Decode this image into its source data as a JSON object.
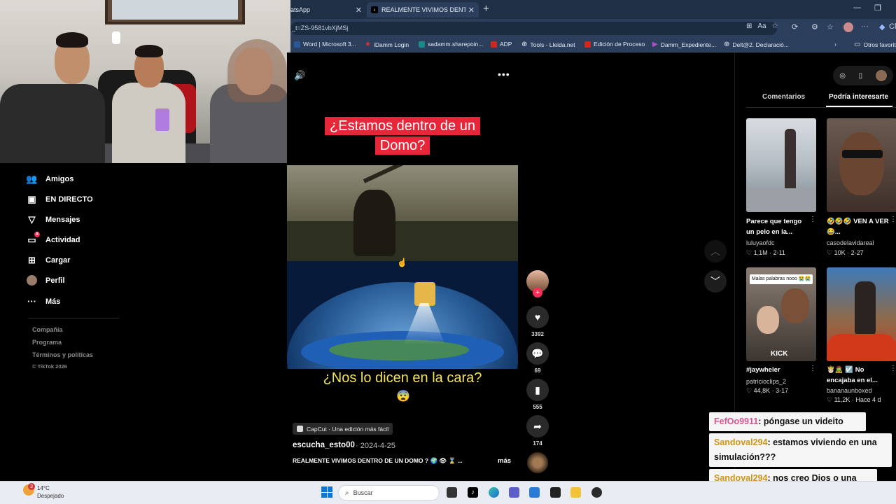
{
  "browser": {
    "tabs": [
      {
        "label": "atsApp"
      },
      {
        "label": "REALMENTE VIVIMOS DENTRO DE"
      }
    ],
    "address": "_t=ZS-9581vbXjMSj",
    "bookmarks": [
      {
        "label": "Word | Microsoft 3..."
      },
      {
        "label": "iDamm Login"
      },
      {
        "label": "sadamm.sharepoin..."
      },
      {
        "label": "ADP"
      },
      {
        "label": "Tools - Lleida.net"
      },
      {
        "label": "Edición de Proceso"
      },
      {
        "label": "Damm_Expediente..."
      },
      {
        "label": "Delt@2. Declaració..."
      },
      {
        "label": "Otros favorit"
      }
    ],
    "profile_label": "Cl"
  },
  "sidebar": {
    "items": [
      {
        "label": "Amigos",
        "icon": "friends-icon"
      },
      {
        "label": "EN DIRECTO",
        "icon": "live-icon"
      },
      {
        "label": "Mensajes",
        "icon": "messages-icon"
      },
      {
        "label": "Actividad",
        "icon": "activity-icon",
        "badge": "8"
      },
      {
        "label": "Cargar",
        "icon": "upload-icon"
      },
      {
        "label": "Perfil",
        "icon": "profile-avatar"
      },
      {
        "label": "Más",
        "icon": "more-icon"
      }
    ],
    "footer": {
      "company": "Compañía",
      "program": "Programa",
      "terms": "Términos y políticas",
      "copyright": "© TikTok 2026"
    }
  },
  "video": {
    "title_overlay": "¿Estamos dentro de un Domo?",
    "caption": "¿Nos lo dicen en la cara?",
    "caption_emoji": "😨",
    "capcut": "CapCut · Una edición más fácil",
    "author": "escucha_esto00",
    "date": "· 2024-4-25",
    "description": "REALMENTE VIVIMOS DENTRO DE UN DOMO ? 🌍 👁 ⌛ ...",
    "more": "más",
    "likes": "3392",
    "comments": "69",
    "saves": "555",
    "shares": "174"
  },
  "right_panel": {
    "tabs": [
      "Comentarios",
      "Podría interesarte"
    ],
    "cards": [
      {
        "title": "Parece que tengo un pelo en la...",
        "user": "luluyaofdc",
        "likes": "♡ 1,1M",
        "date": "· 2-11"
      },
      {
        "title": "🤣🤣🤣 VEN A VER😂...",
        "user": "casodelavidareal",
        "likes": "♡ 10K",
        "date": "· 2-27"
      },
      {
        "title": "#jaywheler",
        "user": "patricioclips_2",
        "likes": "♡ 44,8K",
        "date": "· 3-17",
        "thumb_text": "Malas palabras nooo 😭😭",
        "thumb_brand": "KICK"
      },
      {
        "title": "🤴🏻🧟 ☑️ No encajaba en el...",
        "user": "bananaunboxed",
        "likes": "♡ 11,2K",
        "date": "· Hace 4 d"
      }
    ]
  },
  "chat": [
    {
      "user": "FefOo9911",
      "message": ": póngase un videito"
    },
    {
      "user": "Sandoval294",
      "message": ": estamos viviendo en una simulación???"
    },
    {
      "user": "Sandoval294",
      "message": ": nos creo Dios o una raza alienijena"
    }
  ],
  "taskbar": {
    "weather_badge": "3",
    "temp": "14°C",
    "weather": "Despejado",
    "search_placeholder": "Buscar"
  }
}
